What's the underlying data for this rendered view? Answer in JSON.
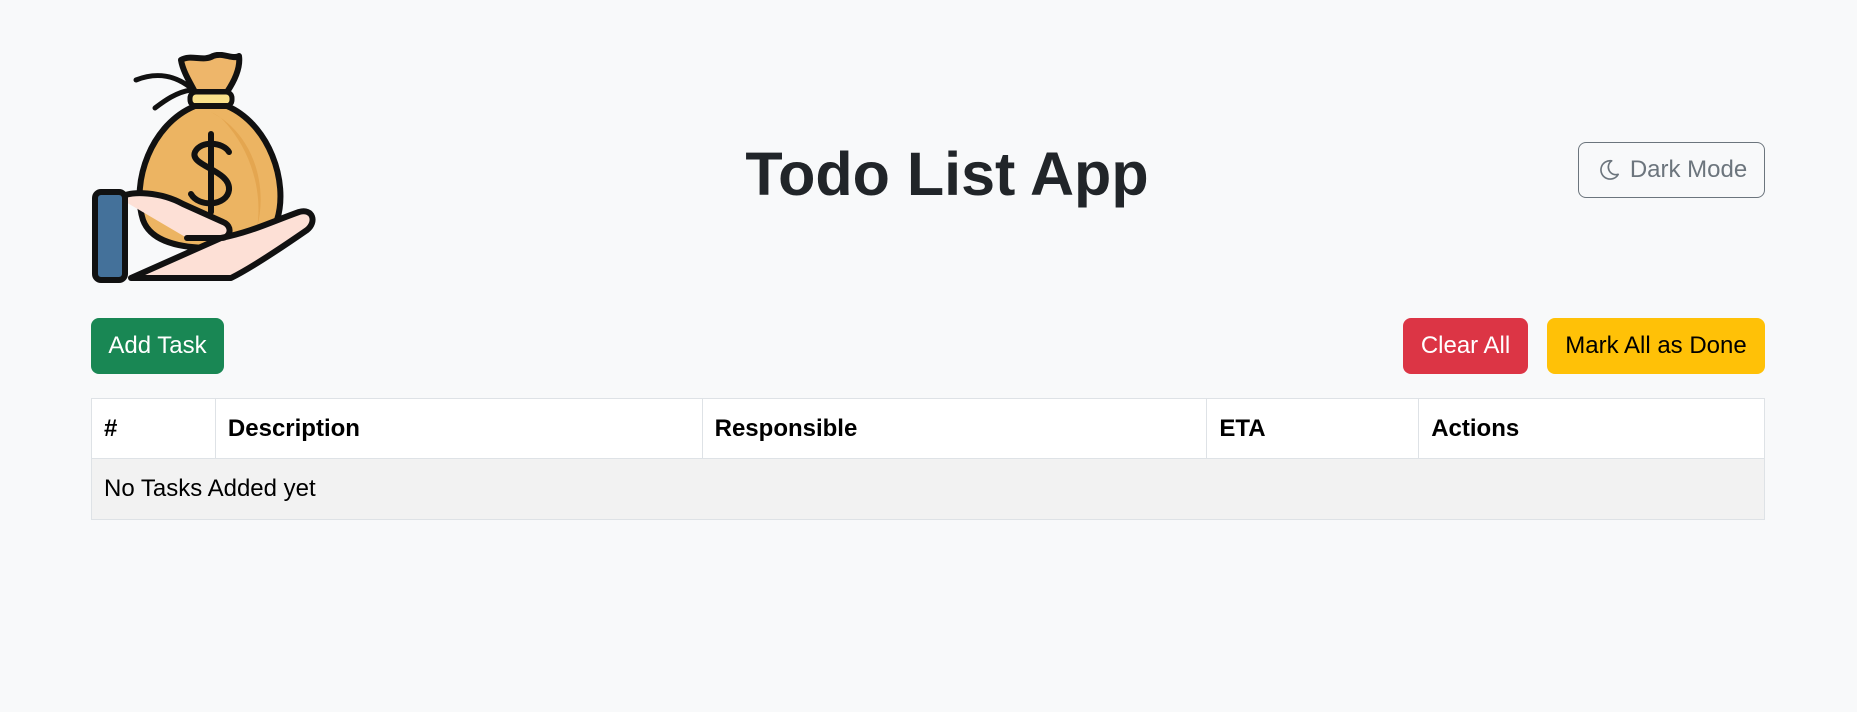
{
  "header": {
    "title": "Todo List App",
    "logo_icon": "money-bag-hand-icon",
    "dark_mode_label": "Dark Mode",
    "dark_mode_icon": "moon-icon"
  },
  "toolbar": {
    "add_task_label": "Add Task",
    "clear_all_label": "Clear All",
    "mark_all_done_label": "Mark All as Done"
  },
  "table": {
    "columns": [
      "#",
      "Description",
      "Responsible",
      "ETA",
      "Actions"
    ],
    "empty_message": "No Tasks Added yet"
  },
  "colors": {
    "page_background": "#f8f9fa",
    "success": "#198754",
    "danger": "#dc3545",
    "warning": "#ffc107",
    "secondary": "#6c757d"
  }
}
